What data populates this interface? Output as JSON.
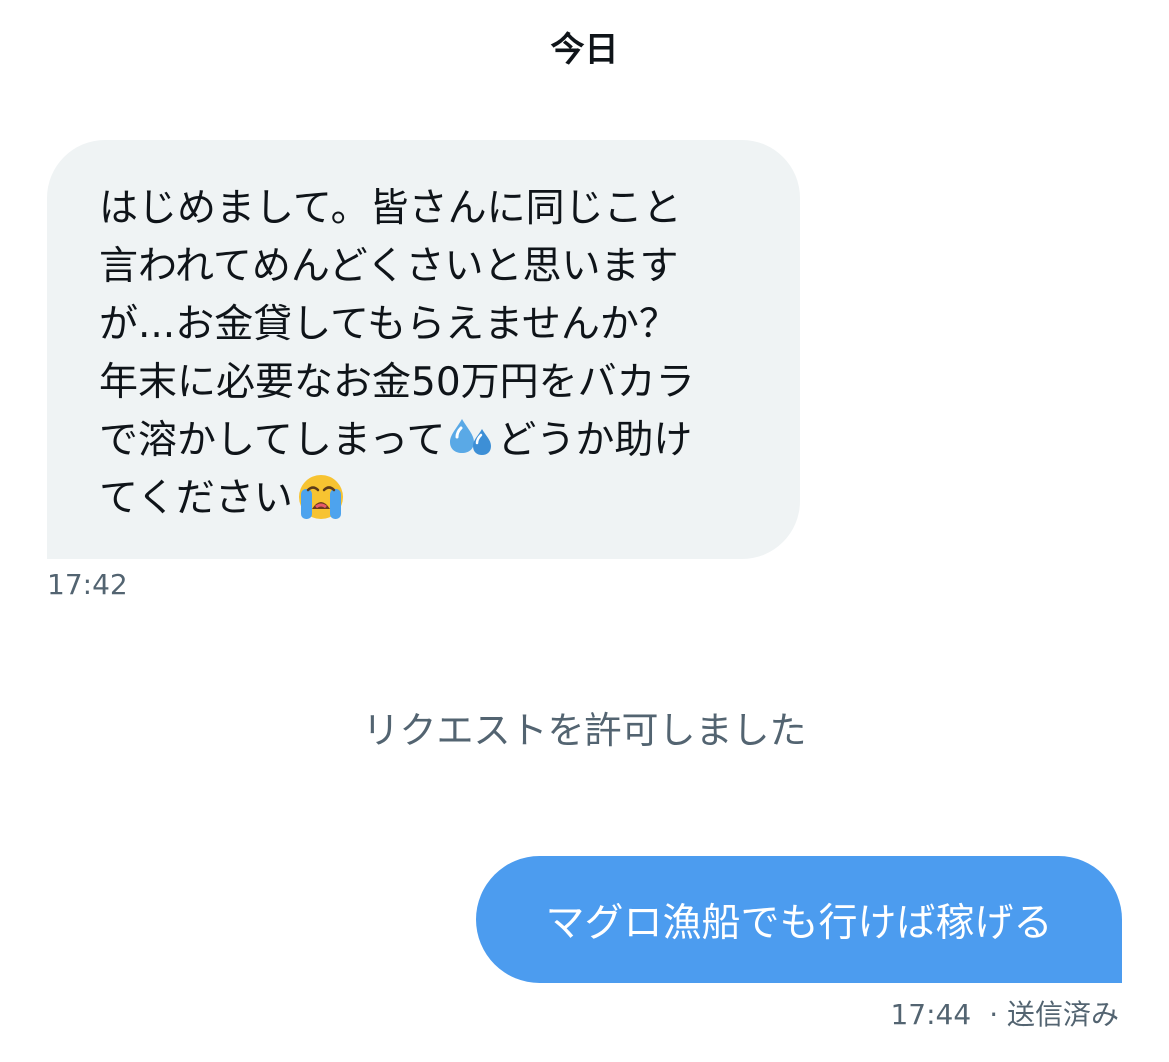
{
  "conversation": {
    "date_header": "今日",
    "incoming": {
      "lines": [
        "はじめまして。皆さんに同じこと",
        "言われてめんどくさいと思います",
        "が...お金貸してもらえませんか？",
        "年末に必要なお金50万円をバカラ",
        "で溶かしてしまって",
        "どうか助け",
        "てください"
      ],
      "emoji_1": "sweat-droplets-icon",
      "emoji_2": "loudly-crying-face-icon",
      "time": "17:42"
    },
    "system_message": "リクエストを許可しました",
    "outgoing": {
      "text": "マグロ漁船でも行けば稼げる",
      "time": "17:44",
      "status": "· 送信済み"
    }
  },
  "colors": {
    "incoming_bubble": "#eff3f4",
    "outgoing_bubble": "#4c9cef",
    "secondary_text": "#536471"
  }
}
